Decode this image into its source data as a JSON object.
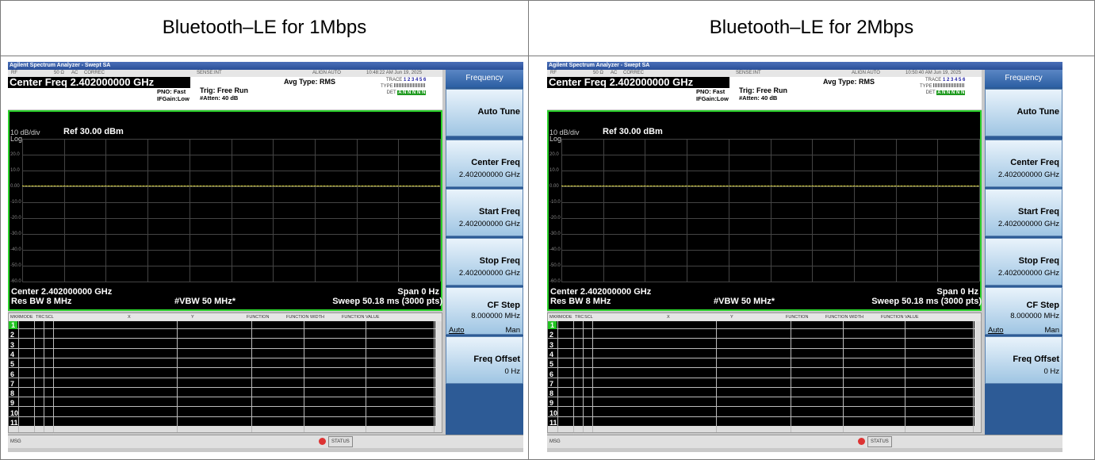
{
  "captions": {
    "left": "Bluetooth–LE for 1Mbps",
    "right": "Bluetooth–LE for 2Mbps"
  },
  "panels": [
    {
      "window_title": "Agilent Spectrum Analyzer - Swept SA",
      "status": {
        "mode": "RF",
        "impedance": "50 Ω",
        "coupling": "AC",
        "correc": "CORREC",
        "sense": "SENSE:INT",
        "align": "ALIGN AUTO",
        "timestamp": "10:48:22 AM Jun 19, 2025"
      },
      "center_freq": "Center Freq 2.402000000 GHz",
      "pno": "PNO: Fast",
      "ifgain": "IFGain:Low",
      "trig": "Trig: Free Run",
      "atten": "#Atten: 40 dB",
      "avg_type": "Avg Type: RMS",
      "trace_labels": {
        "trace": "TRACE",
        "type": "TYPE",
        "det": "DET",
        "trace_nums": "1 2 3 4 5 6",
        "det_vals": "A N N N N N"
      },
      "scale": "10 dB/div",
      "scale_type": "Log",
      "ref": "Ref 30.00 dBm",
      "y_ticks": [
        "20.0",
        "10.0",
        "0.00",
        "-10.0",
        "-20.0",
        "-30.0",
        "-40.0",
        "-50.0",
        "-60.0"
      ],
      "footer": {
        "center": "Center 2.402000000 GHz",
        "span": "Span 0 Hz",
        "rbw": "Res BW 8 MHz",
        "vbw": "#VBW 50 MHz*",
        "sweep": "Sweep  50.18 ms (3000 pts)"
      },
      "marker_table": {
        "headers": [
          "MKR",
          "MODE",
          "TRC",
          "SCL",
          "X",
          "Y",
          "FUNCTION",
          "FUNCTION WIDTH",
          "FUNCTION VALUE"
        ],
        "rows": [
          "1",
          "2",
          "3",
          "4",
          "5",
          "6",
          "7",
          "8",
          "9",
          "10",
          "11"
        ]
      },
      "msg": "MSG",
      "status_label": "STATUS",
      "softkeys": {
        "header": "Frequency",
        "items": [
          {
            "title": "Auto Tune",
            "value": ""
          },
          {
            "title": "Center Freq",
            "value": "2.402000000 GHz"
          },
          {
            "title": "Start Freq",
            "value": "2.402000000 GHz"
          },
          {
            "title": "Stop Freq",
            "value": "2.402000000 GHz"
          },
          {
            "title": "CF Step",
            "value": "8.000000 MHz",
            "auto": "Auto",
            "man": "Man"
          },
          {
            "title": "Freq Offset",
            "value": "0 Hz"
          }
        ]
      }
    },
    {
      "window_title": "Agilent Spectrum Analyzer - Swept SA",
      "status": {
        "mode": "RF",
        "impedance": "50 Ω",
        "coupling": "AC",
        "correc": "CORREC",
        "sense": "SENSE:INT",
        "align": "ALIGN AUTO",
        "timestamp": "10:50:40 AM Jun 19, 2025"
      },
      "center_freq": "Center Freq 2.402000000 GHz",
      "pno": "PNO: Fast",
      "ifgain": "IFGain:Low",
      "trig": "Trig: Free Run",
      "atten": "#Atten: 40 dB",
      "avg_type": "Avg Type: RMS",
      "trace_labels": {
        "trace": "TRACE",
        "type": "TYPE",
        "det": "DET",
        "trace_nums": "1 2 3 4 5 6",
        "det_vals": "A N N N N N"
      },
      "scale": "10 dB/div",
      "scale_type": "Log",
      "ref": "Ref 30.00 dBm",
      "y_ticks": [
        "20.0",
        "10.0",
        "0.00",
        "-10.0",
        "-20.0",
        "-30.0",
        "-40.0",
        "-50.0",
        "-60.0"
      ],
      "footer": {
        "center": "Center 2.402000000 GHz",
        "span": "Span 0 Hz",
        "rbw": "Res BW 8 MHz",
        "vbw": "#VBW 50 MHz*",
        "sweep": "Sweep  50.18 ms (3000 pts)"
      },
      "marker_table": {
        "headers": [
          "MKR",
          "MODE",
          "TRC",
          "SCL",
          "X",
          "Y",
          "FUNCTION",
          "FUNCTION WIDTH",
          "FUNCTION VALUE"
        ],
        "rows": [
          "1",
          "2",
          "3",
          "4",
          "5",
          "6",
          "7",
          "8",
          "9",
          "10",
          "11"
        ]
      },
      "msg": "MSG",
      "status_label": "STATUS",
      "softkeys": {
        "header": "Frequency",
        "items": [
          {
            "title": "Auto Tune",
            "value": ""
          },
          {
            "title": "Center Freq",
            "value": "2.402000000 GHz"
          },
          {
            "title": "Start Freq",
            "value": "2.402000000 GHz"
          },
          {
            "title": "Stop Freq",
            "value": "2.402000000 GHz"
          },
          {
            "title": "CF Step",
            "value": "8.000000 MHz",
            "auto": "Auto",
            "man": "Man"
          },
          {
            "title": "Freq Offset",
            "value": "0 Hz"
          }
        ]
      }
    }
  ],
  "colors": {
    "trace": "#e8e34a",
    "frame": "#2bd12b",
    "softkey_bg": "#2d5b96",
    "marker_selected": "#22c322"
  }
}
